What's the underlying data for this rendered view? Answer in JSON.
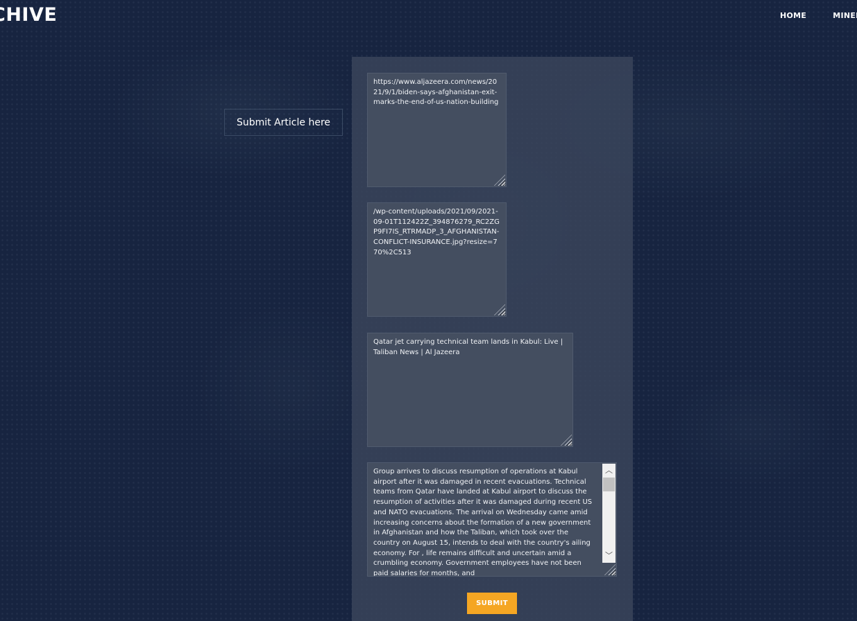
{
  "header": {
    "logo_text": "CHIVE",
    "nav": [
      {
        "label": "HOME"
      },
      {
        "label": "MINED"
      }
    ]
  },
  "sidebar": {
    "submit_label": "Submit Article here"
  },
  "form": {
    "url_value": "https://www.aljazeera.com/news/2021/9/1/biden-says-afghanistan-exit-marks-the-end-of-us-nation-building",
    "image_value": "/wp-content/uploads/2021/09/2021-09-01T112422Z_394876279_RC2ZGP9FI7IS_RTRMADP_3_AFGHANISTAN-CONFLICT-INSURANCE.jpg?resize=770%2C513",
    "title_value": "Qatar jet carrying technical team lands in Kabul: Live | Taliban News | Al Jazeera",
    "body_value": "Group arrives to discuss resumption of operations at Kabul airport after it was damaged in recent evacuations. Technical teams from Qatar have landed at Kabul airport to discuss the resumption of activities after it was damaged during recent US and NATO evacuations. The arrival on Wednesday came amid increasing concerns about the formation of a new government in Afghanistan and how the Taliban, which took over the country on August 15, intends to deal with the country's ailing economy. For  , life remains difficult and uncertain amid a crumbling economy. Government employees have not been paid salaries for months, and",
    "submit_label": "SUBMIT"
  },
  "colors": {
    "background": "#172440",
    "panel": "#3a465c",
    "textarea": "#444e60",
    "accent": "#f5a623"
  }
}
